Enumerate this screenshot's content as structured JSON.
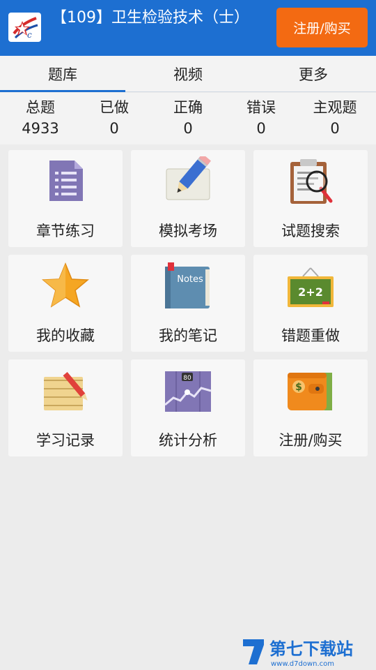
{
  "header": {
    "title": "【109】卫生检验技术（士）",
    "buy_label": "注册/购买"
  },
  "tabs": [
    {
      "label": "题库",
      "active": true
    },
    {
      "label": "视频",
      "active": false
    },
    {
      "label": "更多",
      "active": false
    }
  ],
  "stats": [
    {
      "label": "总题",
      "value": "4933"
    },
    {
      "label": "已做",
      "value": "0"
    },
    {
      "label": "正确",
      "value": "0"
    },
    {
      "label": "错误",
      "value": "0"
    },
    {
      "label": "主观题",
      "value": "0"
    }
  ],
  "tiles": [
    {
      "label": "章节练习",
      "icon": "document-list-icon"
    },
    {
      "label": "模拟考场",
      "icon": "pencil-paper-icon"
    },
    {
      "label": "试题搜索",
      "icon": "clipboard-search-icon"
    },
    {
      "label": "我的收藏",
      "icon": "star-icon"
    },
    {
      "label": "我的笔记",
      "icon": "notes-book-icon"
    },
    {
      "label": "错题重做",
      "icon": "chalkboard-icon"
    },
    {
      "label": "学习记录",
      "icon": "notepad-pencil-icon"
    },
    {
      "label": "统计分析",
      "icon": "chart-icon"
    },
    {
      "label": "注册/购买",
      "icon": "wallet-icon"
    }
  ],
  "icon_text": {
    "notes": "Notes",
    "board": "2+2",
    "chart": "80",
    "dollar": "$"
  },
  "watermark": {
    "name": "第七下载站",
    "url": "www.d7down.com"
  },
  "colors": {
    "header": "#1d6fd1",
    "button": "#f36a12",
    "background": "#ececec"
  }
}
